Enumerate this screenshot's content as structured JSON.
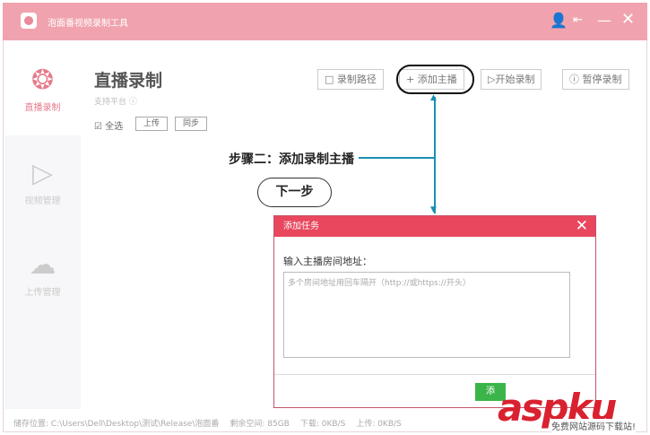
{
  "app": {
    "title": "泡面番视频录制工具"
  },
  "sidebar": {
    "items": [
      {
        "label": "直播录制"
      },
      {
        "label": "视频管理"
      },
      {
        "label": "上传管理"
      }
    ]
  },
  "main": {
    "title": "直播录制",
    "support": "支持平台",
    "select_all": "全选",
    "upload": "上传",
    "sync": "同步",
    "toolbar": {
      "path": "录制路径",
      "add": "添加主播",
      "start": "开始录制",
      "pause": "暂停录制"
    }
  },
  "annotation": {
    "step": "步骤二：添加录制主播",
    "next": "下一步"
  },
  "dialog": {
    "title": "添加任务",
    "label": "输入主播房间地址：",
    "placeholder": "多个房间地址用回车隔开（http://或https://开头）",
    "confirm": "添"
  },
  "status": {
    "path": "储存位置: C:\\Users\\Dell\\Desktop\\测试\\Release\\泡面番",
    "space": "剩余空间: 85GB",
    "download": "下载: 0KB/S",
    "upload": "上传: 0KB/S"
  },
  "watermark": {
    "brand": "aspku",
    "sub": "免费网站源码下载站!"
  }
}
